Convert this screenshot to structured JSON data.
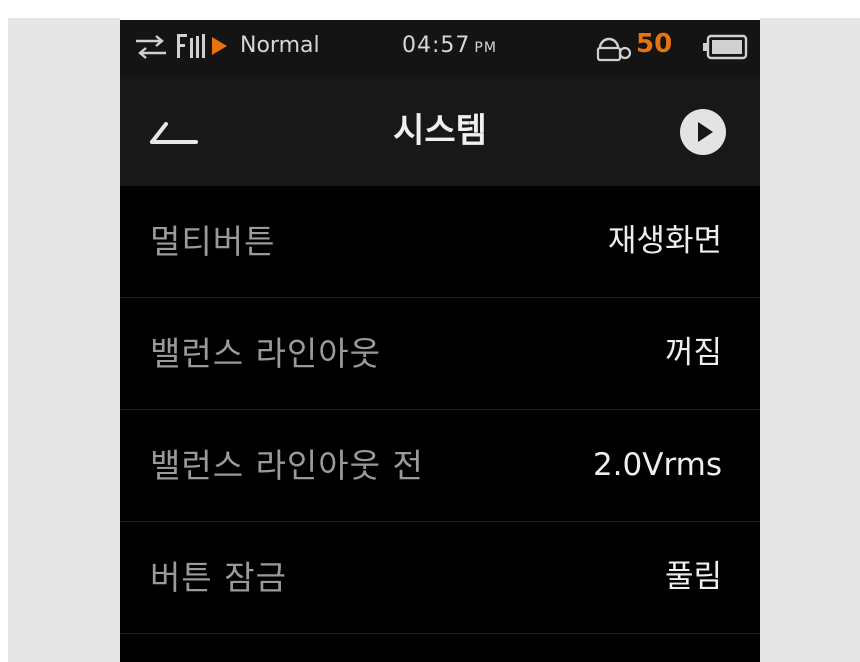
{
  "status_bar": {
    "playback_mode": "Normal",
    "time": "04:57",
    "ampm": "PM",
    "volume": "50",
    "icons": [
      "repeat-icon",
      "filter-level-icon",
      "play-state-icon",
      "key-lock-icon",
      "battery-icon"
    ],
    "accent_color": "#e8720c"
  },
  "header": {
    "title": "시스템",
    "back_icon": "back-arrow-icon",
    "play_icon": "now-playing-icon"
  },
  "settings": [
    {
      "label": "멀티버튼",
      "value": "재생화면"
    },
    {
      "label": "밸런스 라인아웃",
      "value": "꺼짐"
    },
    {
      "label": "밸런스 라인아웃 전",
      "value": "2.0Vrms"
    },
    {
      "label": "버튼 잠금",
      "value": "풀림"
    }
  ],
  "colors": {
    "background": "#000000",
    "header_bg": "#181818",
    "label_text": "#9a9a9a",
    "value_text": "#eeeeee"
  }
}
